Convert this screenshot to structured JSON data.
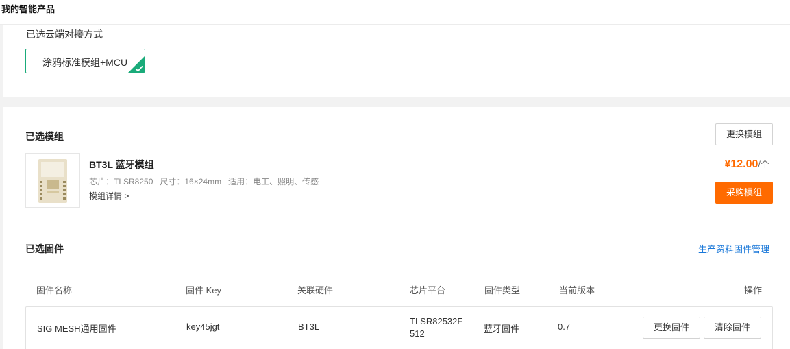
{
  "topbar": {
    "title": "我的智能产品"
  },
  "cloud": {
    "label": "已选云端对接方式",
    "option": "涂鸦标准模组+MCU",
    "accent": "#1aab7a"
  },
  "module": {
    "section_title": "已选模组",
    "change_button": "更换模组",
    "name": "BT3L 蓝牙模组",
    "chip": "芯片：TLSR8250",
    "size": "尺寸：16×24mm",
    "usage": "适用：电工、照明、传感",
    "detail_link": "模组详情 >",
    "price": "¥12.00",
    "price_unit": "/个",
    "buy_button": "采购模组",
    "price_color": "#ff6a00"
  },
  "firmware": {
    "section_title": "已选固件",
    "manage_link": "生产资料固件管理",
    "columns": [
      "固件名称",
      "固件 Key",
      "关联硬件",
      "芯片平台",
      "固件类型",
      "当前版本",
      "操作"
    ],
    "rows": [
      {
        "name": "SIG MESH通用固件",
        "key": "key45jgt",
        "hardware": "BT3L",
        "platform": "TLSR82532F512",
        "type": "蓝牙固件",
        "version": "0.7",
        "change_button": "更换固件",
        "clear_button": "清除固件"
      }
    ]
  }
}
